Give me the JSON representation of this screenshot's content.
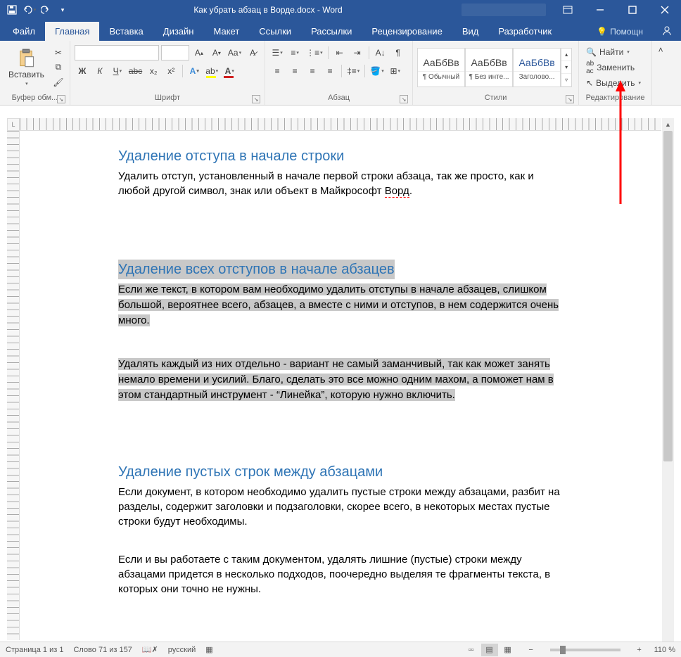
{
  "titlebar": {
    "document_title": "Как убрать абзац в Ворде.docx - Word"
  },
  "menu": {
    "tabs": [
      "Файл",
      "Главная",
      "Вставка",
      "Дизайн",
      "Макет",
      "Ссылки",
      "Рассылки",
      "Рецензирование",
      "Вид",
      "Разработчик"
    ],
    "active_index": 1,
    "help_text": "Помощн"
  },
  "ribbon": {
    "clipboard": {
      "label": "Буфер обм...",
      "paste": "Вставить"
    },
    "font": {
      "label": "Шрифт",
      "name": "",
      "size": "",
      "btns": {
        "bold": "Ж",
        "italic": "К",
        "underline": "Ч",
        "strike": "abc",
        "sub": "x₂",
        "sup": "x²",
        "case": "Aa",
        "clear": "⌫"
      }
    },
    "paragraph": {
      "label": "Абзац"
    },
    "styles": {
      "label": "Стили",
      "items": [
        {
          "preview": "АаБбВв",
          "name": "¶ Обычный"
        },
        {
          "preview": "АаБбВв",
          "name": "¶ Без инте..."
        },
        {
          "preview": "АаБбВв",
          "name": "Заголово..."
        }
      ]
    },
    "editing": {
      "label": "Редактирование",
      "find": "Найти",
      "replace": "Заменить",
      "select": "Выделить"
    }
  },
  "ruler_corner": "L",
  "document": {
    "h1": "Удаление отступа в начале строки",
    "p1": "Удалить отступ, установленный в начале первой строки абзаца, так же просто, как и любой другой символ, знак или объект в Майкрософт ",
    "p1_red": "Ворд",
    "p1_tail": ".",
    "h2": "Удаление всех отступов в начале абзацев",
    "p2": "Если же текст, в котором вам необходимо удалить отступы в начале абзацев, слишком большой, вероятнее всего, абзацев, а вместе с ними и отступов, в нем содержится очень много.",
    "p3": "Удалять каждый из них отдельно - вариант не самый заманчивый, так как может занять немало времени и усилий. Благо, сделать это все можно одним махом, а поможет нам в этом стандартный инструмент - “Линейка”, которую нужно включить.",
    "h3": "Удаление пустых строк между абзацами",
    "p4": "Если документ, в котором необходимо удалить пустые строки между абзацами, разбит на разделы, содержит заголовки и подзаголовки, скорее всего, в некоторых местах пустые строки будут необходимы.",
    "p5": "Если и вы работаете с таким документом, удалять лишние (пустые) строки между абзацами придется в несколько подходов, поочередно выделяя те фрагменты текста, в которых они точно не нужны."
  },
  "status": {
    "page": "Страница 1 из 1",
    "words": "Слово 71 из 157",
    "lang": "русский",
    "zoom": "110 %"
  }
}
